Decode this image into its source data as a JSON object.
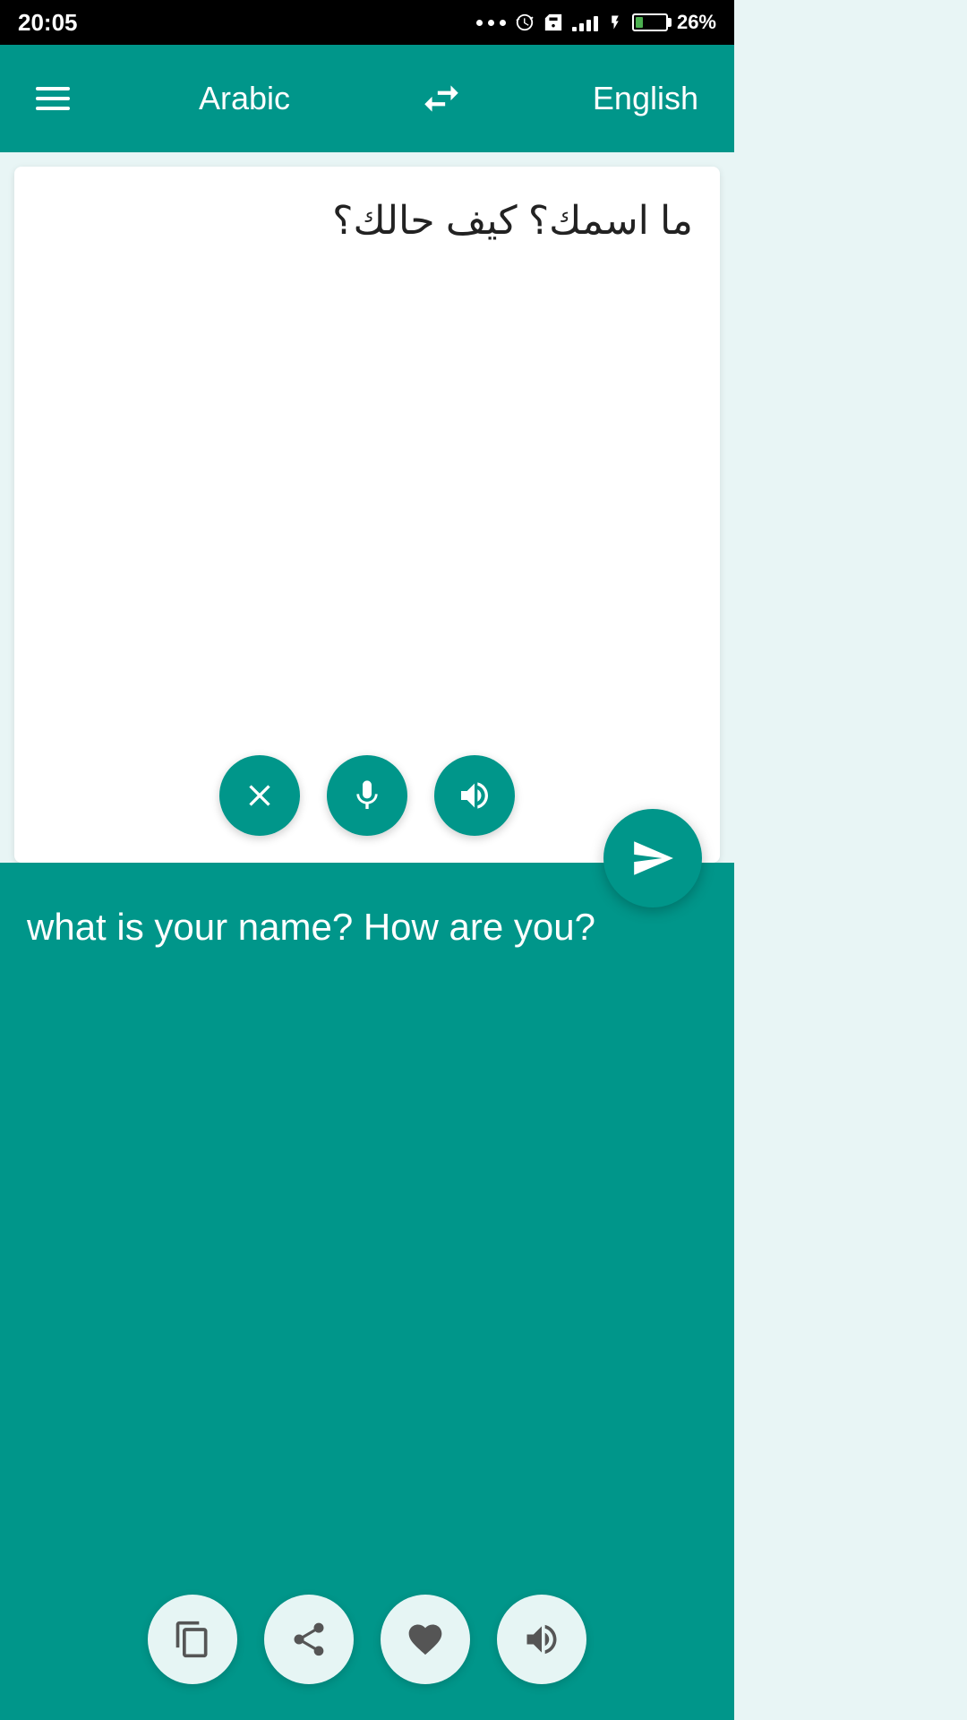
{
  "statusBar": {
    "time": "20:05",
    "battery": "26%",
    "batteryPercent": 26
  },
  "header": {
    "menuLabel": "menu",
    "sourceLang": "Arabic",
    "swapLabel": "swap languages",
    "targetLang": "English"
  },
  "inputPanel": {
    "text": "ما اسمك؟ كيف حالك؟",
    "clearLabel": "clear",
    "micLabel": "microphone",
    "speakLabel": "speak",
    "sendLabel": "send"
  },
  "outputPanel": {
    "text": "what is your name? How are you?",
    "copyLabel": "copy",
    "shareLabel": "share",
    "favoriteLabel": "favorite",
    "speakLabel": "speak"
  }
}
